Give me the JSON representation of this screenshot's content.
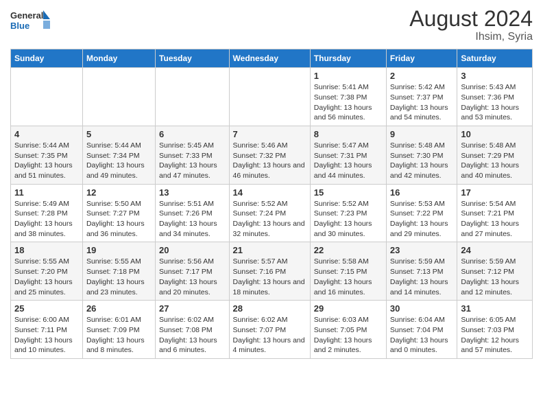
{
  "header": {
    "logo_line1": "General",
    "logo_line2": "Blue",
    "title": "August 2024",
    "subtitle": "Ihsim, Syria"
  },
  "calendar": {
    "days_of_week": [
      "Sunday",
      "Monday",
      "Tuesday",
      "Wednesday",
      "Thursday",
      "Friday",
      "Saturday"
    ],
    "weeks": [
      [
        {
          "date": "",
          "info": ""
        },
        {
          "date": "",
          "info": ""
        },
        {
          "date": "",
          "info": ""
        },
        {
          "date": "",
          "info": ""
        },
        {
          "date": "1",
          "sunrise": "5:41 AM",
          "sunset": "7:38 PM",
          "daylight": "13 hours and 56 minutes."
        },
        {
          "date": "2",
          "sunrise": "5:42 AM",
          "sunset": "7:37 PM",
          "daylight": "13 hours and 54 minutes."
        },
        {
          "date": "3",
          "sunrise": "5:43 AM",
          "sunset": "7:36 PM",
          "daylight": "13 hours and 53 minutes."
        }
      ],
      [
        {
          "date": "4",
          "sunrise": "5:44 AM",
          "sunset": "7:35 PM",
          "daylight": "13 hours and 51 minutes."
        },
        {
          "date": "5",
          "sunrise": "5:44 AM",
          "sunset": "7:34 PM",
          "daylight": "13 hours and 49 minutes."
        },
        {
          "date": "6",
          "sunrise": "5:45 AM",
          "sunset": "7:33 PM",
          "daylight": "13 hours and 47 minutes."
        },
        {
          "date": "7",
          "sunrise": "5:46 AM",
          "sunset": "7:32 PM",
          "daylight": "13 hours and 46 minutes."
        },
        {
          "date": "8",
          "sunrise": "5:47 AM",
          "sunset": "7:31 PM",
          "daylight": "13 hours and 44 minutes."
        },
        {
          "date": "9",
          "sunrise": "5:48 AM",
          "sunset": "7:30 PM",
          "daylight": "13 hours and 42 minutes."
        },
        {
          "date": "10",
          "sunrise": "5:48 AM",
          "sunset": "7:29 PM",
          "daylight": "13 hours and 40 minutes."
        }
      ],
      [
        {
          "date": "11",
          "sunrise": "5:49 AM",
          "sunset": "7:28 PM",
          "daylight": "13 hours and 38 minutes."
        },
        {
          "date": "12",
          "sunrise": "5:50 AM",
          "sunset": "7:27 PM",
          "daylight": "13 hours and 36 minutes."
        },
        {
          "date": "13",
          "sunrise": "5:51 AM",
          "sunset": "7:26 PM",
          "daylight": "13 hours and 34 minutes."
        },
        {
          "date": "14",
          "sunrise": "5:52 AM",
          "sunset": "7:24 PM",
          "daylight": "13 hours and 32 minutes."
        },
        {
          "date": "15",
          "sunrise": "5:52 AM",
          "sunset": "7:23 PM",
          "daylight": "13 hours and 30 minutes."
        },
        {
          "date": "16",
          "sunrise": "5:53 AM",
          "sunset": "7:22 PM",
          "daylight": "13 hours and 29 minutes."
        },
        {
          "date": "17",
          "sunrise": "5:54 AM",
          "sunset": "7:21 PM",
          "daylight": "13 hours and 27 minutes."
        }
      ],
      [
        {
          "date": "18",
          "sunrise": "5:55 AM",
          "sunset": "7:20 PM",
          "daylight": "13 hours and 25 minutes."
        },
        {
          "date": "19",
          "sunrise": "5:55 AM",
          "sunset": "7:18 PM",
          "daylight": "13 hours and 23 minutes."
        },
        {
          "date": "20",
          "sunrise": "5:56 AM",
          "sunset": "7:17 PM",
          "daylight": "13 hours and 20 minutes."
        },
        {
          "date": "21",
          "sunrise": "5:57 AM",
          "sunset": "7:16 PM",
          "daylight": "13 hours and 18 minutes."
        },
        {
          "date": "22",
          "sunrise": "5:58 AM",
          "sunset": "7:15 PM",
          "daylight": "13 hours and 16 minutes."
        },
        {
          "date": "23",
          "sunrise": "5:59 AM",
          "sunset": "7:13 PM",
          "daylight": "13 hours and 14 minutes."
        },
        {
          "date": "24",
          "sunrise": "5:59 AM",
          "sunset": "7:12 PM",
          "daylight": "13 hours and 12 minutes."
        }
      ],
      [
        {
          "date": "25",
          "sunrise": "6:00 AM",
          "sunset": "7:11 PM",
          "daylight": "13 hours and 10 minutes."
        },
        {
          "date": "26",
          "sunrise": "6:01 AM",
          "sunset": "7:09 PM",
          "daylight": "13 hours and 8 minutes."
        },
        {
          "date": "27",
          "sunrise": "6:02 AM",
          "sunset": "7:08 PM",
          "daylight": "13 hours and 6 minutes."
        },
        {
          "date": "28",
          "sunrise": "6:02 AM",
          "sunset": "7:07 PM",
          "daylight": "13 hours and 4 minutes."
        },
        {
          "date": "29",
          "sunrise": "6:03 AM",
          "sunset": "7:05 PM",
          "daylight": "13 hours and 2 minutes."
        },
        {
          "date": "30",
          "sunrise": "6:04 AM",
          "sunset": "7:04 PM",
          "daylight": "13 hours and 0 minutes."
        },
        {
          "date": "31",
          "sunrise": "6:05 AM",
          "sunset": "7:03 PM",
          "daylight": "12 hours and 57 minutes."
        }
      ]
    ]
  }
}
